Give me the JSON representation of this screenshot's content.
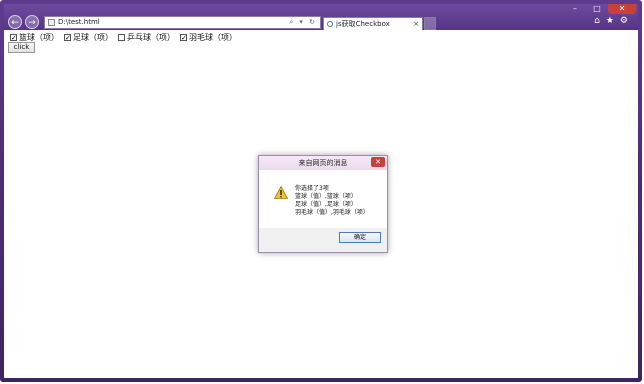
{
  "browser": {
    "address": "D:\\test.html",
    "address_controls": "⌕ ▾ ↻",
    "tab_title": "js获取Checkbox",
    "tab_close": "×",
    "back_icon": "←",
    "forward_icon": "→",
    "window_buttons": {
      "minimize": "–",
      "maximize": "□",
      "close": "✕"
    },
    "tools": {
      "home": "⌂",
      "favorites": "★",
      "settings": "⚙"
    }
  },
  "page": {
    "checkboxes": [
      {
        "label": "篮球（项）",
        "checked": true,
        "mark": "✓"
      },
      {
        "label": "足球（项）",
        "checked": true,
        "mark": "✓"
      },
      {
        "label": "乒乓球（项）",
        "checked": false,
        "mark": ""
      },
      {
        "label": "羽毛球（项）",
        "checked": true,
        "mark": "✓"
      }
    ],
    "button_label": "click"
  },
  "dialog": {
    "title": "来自网页的消息",
    "close": "✕",
    "icon": "warning-icon",
    "lines": [
      "你选择了3项",
      "篮球（值）,篮球（项）",
      "足球（值）,足球（项）",
      "羽毛球（值）,羽毛球（项）"
    ],
    "ok_label": "确定"
  }
}
